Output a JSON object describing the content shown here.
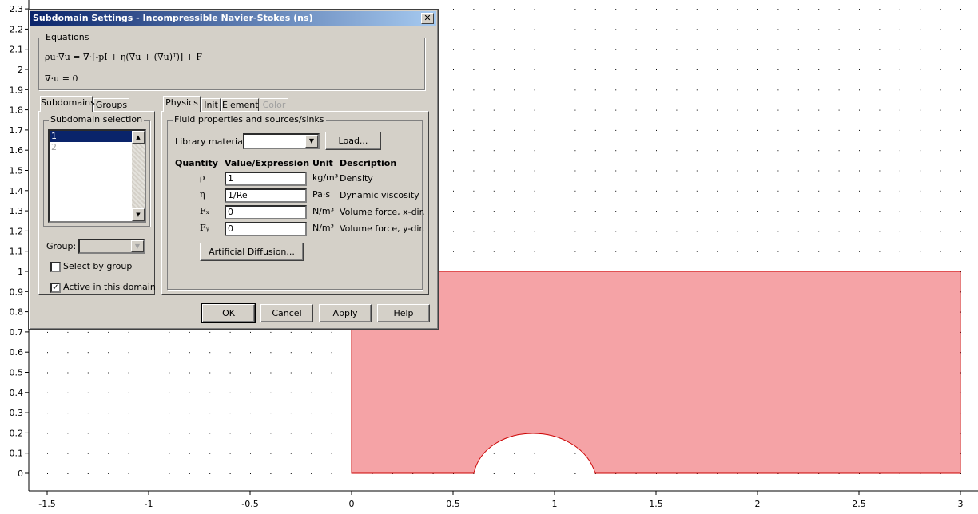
{
  "plot": {
    "x_ticks": [
      "-1.5",
      "-1",
      "-0.5",
      "0",
      "0.5",
      "1",
      "1.5",
      "2",
      "2.5",
      "3"
    ],
    "y_ticks": [
      "0",
      "0.1",
      "0.2",
      "0.3",
      "0.4",
      "0.5",
      "0.6",
      "0.7",
      "0.8",
      "0.9",
      "1",
      "1.1",
      "1.2",
      "1.3",
      "1.4",
      "1.5",
      "1.6",
      "1.7",
      "1.8",
      "1.9",
      "2",
      "2.1",
      "2.2",
      "2.3"
    ],
    "domain_fill": "#f5a3a6",
    "domain_edge": "#cc0000"
  },
  "dialog": {
    "title": "Subdomain Settings - Incompressible Navier-Stokes (ns)",
    "close_label": "✕",
    "equations": {
      "legend": "Equations",
      "line1": "ρu·∇u = ∇·[-pI + η(∇u + (∇u)ᵀ)] + F",
      "line2": "∇·u = 0"
    },
    "left_tabs": [
      "Subdomains",
      "Groups"
    ],
    "subdomain_selection": {
      "legend": "Subdomain selection",
      "items": [
        "1",
        "2"
      ],
      "selected": "1"
    },
    "group_label": "Group:",
    "group_value": "",
    "select_by_group": "Select by group",
    "active_in_domain": "Active in this domain",
    "active_checked": "✓",
    "right_tabs": [
      "Physics",
      "Init",
      "Element",
      "Color"
    ],
    "physics": {
      "legend": "Fluid properties and sources/sinks",
      "library_label": "Library material:",
      "library_value": "",
      "load_button": "Load...",
      "headers": {
        "quantity": "Quantity",
        "value": "Value/Expression",
        "unit": "Unit",
        "description": "Description"
      },
      "rows": [
        {
          "symbol": "ρ",
          "value": "1",
          "unit": "kg/m³",
          "description": "Density"
        },
        {
          "symbol": "η",
          "value": "1/Re",
          "unit": "Pa·s",
          "description": "Dynamic viscosity"
        },
        {
          "symbol": "Fₓ",
          "value": "0",
          "unit": "N/m³",
          "description": "Volume force, x-dir."
        },
        {
          "symbol": "Fᵧ",
          "value": "0",
          "unit": "N/m³",
          "description": "Volume force, y-dir."
        }
      ],
      "artificial_diffusion": "Artificial Diffusion..."
    },
    "buttons": {
      "ok": "OK",
      "cancel": "Cancel",
      "apply": "Apply",
      "help": "Help"
    }
  }
}
